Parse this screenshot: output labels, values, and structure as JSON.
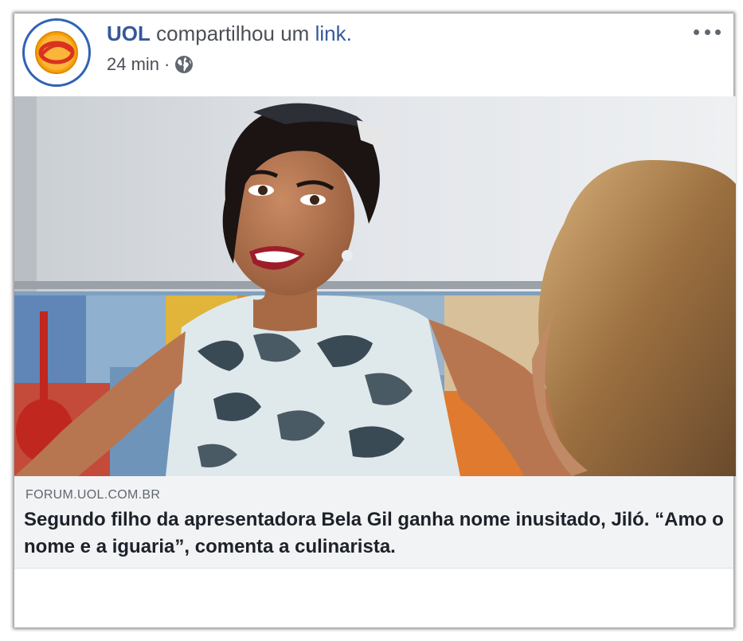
{
  "post": {
    "page_name": "UOL",
    "action_text": "compartilhou um",
    "link_word": "link.",
    "time": "24 min",
    "separator": "·",
    "privacy_icon": "globe-icon",
    "menu_icon": "more-options-icon"
  },
  "link_preview": {
    "image_icon": "photo-woman-kitchen",
    "domain": "FORUM.UOL.COM.BR",
    "headline": "Segundo filho da apresentadora Bela Gil ganha nome inusitado, Jiló. “Amo o nome e a iguaria”, comenta a culinarista."
  },
  "colors": {
    "link_blue": "#365899",
    "avatar_ring": "#2f63b5",
    "logo_orange": "#f5a623",
    "preview_bg": "#f2f3f5"
  }
}
